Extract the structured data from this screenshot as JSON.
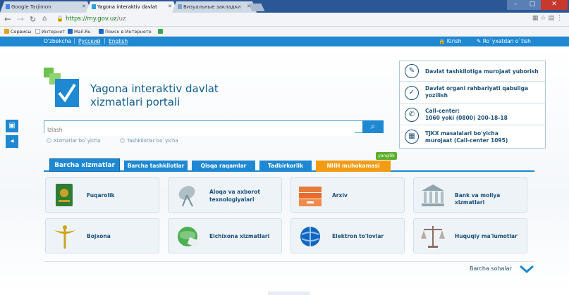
{
  "browser": {
    "tabs": [
      {
        "label": "Google Tarjimon"
      },
      {
        "label": "Yagona interaktiv davlat"
      },
      {
        "label": "Визуальные закладки"
      }
    ],
    "url_prefix": "https://",
    "url_host": "my.gov.uz",
    "url_path": "/uz",
    "bookmarks": [
      {
        "label": "Сервисы",
        "color": "#e2a31d"
      },
      {
        "label": "Интернет",
        "color": "#cfcfcf"
      },
      {
        "label": "Mail.Ru",
        "color": "#1e66c6"
      },
      {
        "label": "Поиск в Интернете",
        "color": "#1e66c6"
      }
    ]
  },
  "topbar": {
    "languages": [
      "O'zbekcha",
      "Русский",
      "English"
    ],
    "login": "Kirish",
    "register": "Ro`yxatdan o`tish"
  },
  "header": {
    "title": "Yagona interaktiv davlat xizmatlari portali"
  },
  "info_panel": [
    {
      "icon": "edit-icon",
      "text": "Davlat tashkilotiga murojaat yuborish"
    },
    {
      "icon": "check-circle-icon",
      "text": "Davlat organi rahbariyati qabuliga yozilish"
    },
    {
      "icon": "phone-icon",
      "text_line1": "Call-center:",
      "text_line2": "1060 yoki (0800) 200-18-18"
    },
    {
      "icon": "building-icon",
      "text_line1": "TJKX masalalari bo'yicha",
      "text_line2": "murojaat (Call-center 1095)"
    }
  ],
  "search": {
    "placeholder": "Izlash",
    "options": [
      "Xizmatlar bo`yicha",
      "Tashkilotlar bo`yicha"
    ]
  },
  "tabs": [
    {
      "label": "Barcha xizmatlar",
      "active": true
    },
    {
      "label": "Barcha tashkilotlar"
    },
    {
      "label": "Qisqa raqamlar"
    },
    {
      "label": "Tadbirkorlik"
    },
    {
      "label": "NHH muhokamasi",
      "badge": "yangilik"
    }
  ],
  "cards": [
    {
      "label": "Fuqarolik",
      "icon": "passport-icon"
    },
    {
      "label_line1": "Aloqa va axborot",
      "label_line2": "texnologiyalari",
      "icon": "satellite-dish-icon"
    },
    {
      "label": "Arxiv",
      "icon": "archive-icon"
    },
    {
      "label": "Bank va moliya xizmatlari",
      "icon": "bank-icon"
    },
    {
      "label": "Bojxona",
      "icon": "customs-emblem-icon"
    },
    {
      "label": "Elchixona xizmatlari",
      "icon": "globe-icon"
    },
    {
      "label": "Elektron to'lovlar",
      "icon": "online-payment-icon"
    },
    {
      "label": "Huquqiy ma'lumotlar",
      "icon": "scales-icon"
    }
  ],
  "more_label": "Barcha sohalar",
  "colors": {
    "primary": "#1e88d2",
    "dark": "#1b4f79",
    "orange": "#f39c12",
    "badge": "#5cae2b"
  }
}
